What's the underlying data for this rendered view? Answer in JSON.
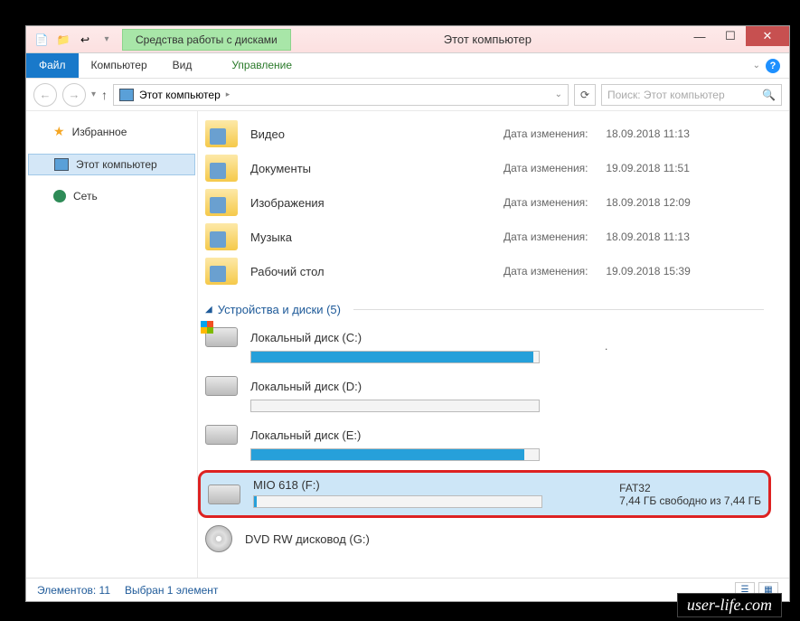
{
  "titlebar": {
    "context_tab": "Средства работы с дисками",
    "title": "Этот компьютер"
  },
  "menu": {
    "file": "Файл",
    "computer": "Компьютер",
    "view": "Вид",
    "manage": "Управление"
  },
  "address": {
    "location": "Этот компьютер",
    "search_placeholder": "Поиск: Этот компьютер"
  },
  "sidebar": {
    "favorites": "Избранное",
    "this_pc": "Этот компьютер",
    "network": "Сеть"
  },
  "folders": [
    {
      "name": "Видео",
      "meta_label": "Дата изменения:",
      "meta_value": "18.09.2018 11:13"
    },
    {
      "name": "Документы",
      "meta_label": "Дата изменения:",
      "meta_value": "19.09.2018 11:51"
    },
    {
      "name": "Изображения",
      "meta_label": "Дата изменения:",
      "meta_value": "18.09.2018 12:09"
    },
    {
      "name": "Музыка",
      "meta_label": "Дата изменения:",
      "meta_value": "18.09.2018 11:13"
    },
    {
      "name": "Рабочий стол",
      "meta_label": "Дата изменения:",
      "meta_value": "19.09.2018 15:39"
    }
  ],
  "devices_header": "Устройства и диски (5)",
  "drives": [
    {
      "name": "Локальный диск (C:)",
      "fill_pct": 98,
      "detail": "."
    },
    {
      "name": "Локальный диск (D:)",
      "fill_pct": 0,
      "detail": ""
    },
    {
      "name": "Локальный диск (E:)",
      "fill_pct": 95,
      "detail": ""
    },
    {
      "name": "MIO 618 (F:)",
      "fill_pct": 1,
      "fs": "FAT32",
      "free": "7,44 ГБ свободно из 7,44 ГБ",
      "selected": true
    },
    {
      "name": "DVD RW дисковод (G:)",
      "dvd": true
    }
  ],
  "statusbar": {
    "items": "Элементов: 11",
    "selection": "Выбран 1 элемент"
  },
  "watermark": "user-life.com"
}
